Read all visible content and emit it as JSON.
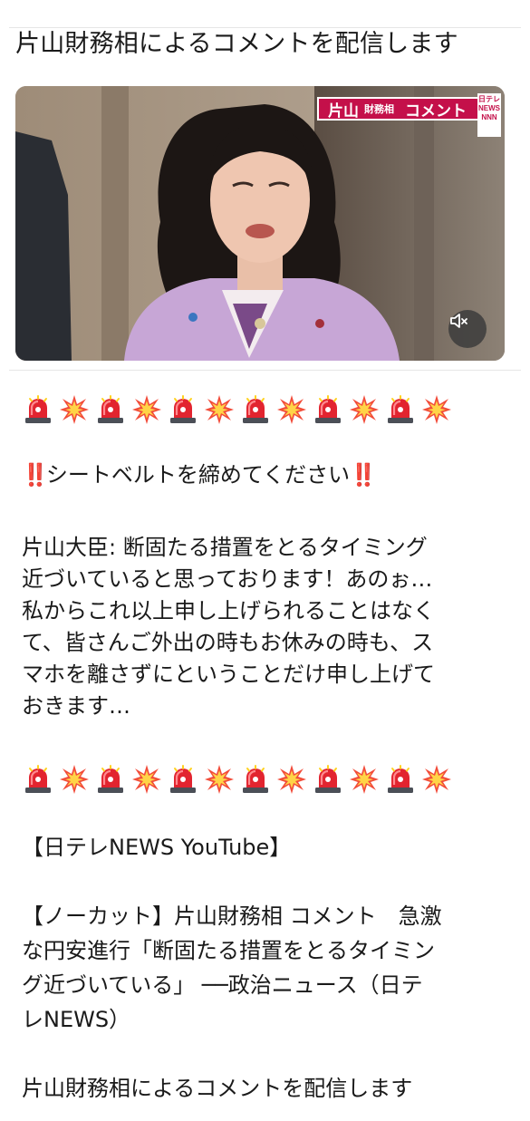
{
  "post": {
    "headline": "片山財務相によるコメントを配信します",
    "video": {
      "caption_name": "片山",
      "caption_role": "財務相",
      "caption_word": "コメント",
      "logo_line1": "日テレ",
      "logo_line2": "NEWS",
      "logo_line3": "NNN",
      "muted": true
    },
    "emoji_row_icons": [
      "police-light-icon",
      "collision-icon",
      "police-light-icon",
      "collision-icon",
      "police-light-icon",
      "collision-icon",
      "police-light-icon",
      "collision-icon",
      "police-light-icon",
      "collision-icon",
      "police-light-icon",
      "collision-icon"
    ],
    "seatbelt_mark": "‼️",
    "seatbelt_text": "シートベルトを締めてください",
    "quote_lines": [
      "片山大臣: 断固たる措置をとるタイミング",
      "近づいていると思っております！あのぉ…",
      "私からこれ以上申し上げられることはなく",
      "て、皆さんご外出の時もお休みの時も、ス",
      "マホを離さずにということだけ申し上げて",
      "おきます…"
    ],
    "source_label": "【日テレNEWS YouTube】",
    "video_title_lines": [
      "【ノーカット】片山財務相 コメント　急激",
      "な円安進行「断固たる措置をとるタイミン",
      "グ近づいている」 ──政治ニュース（日テ",
      "レNEWS）"
    ],
    "footer_text": "片山財務相によるコメントを配信します"
  }
}
